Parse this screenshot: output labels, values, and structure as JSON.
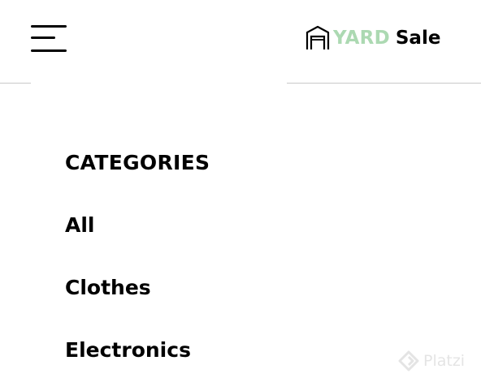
{
  "header": {
    "logo": {
      "icon": "garage-icon",
      "word_accent": "YARD",
      "word_main": "Sale",
      "accent_color": "#acd9b2"
    },
    "menu_icon": "hamburger-menu-icon"
  },
  "menu": {
    "heading": "CATEGORIES",
    "items": [
      {
        "label": "All"
      },
      {
        "label": "Clothes"
      },
      {
        "label": "Electronics"
      }
    ]
  },
  "watermark": {
    "icon": "platzi-logo-icon",
    "text": "Platzi"
  }
}
